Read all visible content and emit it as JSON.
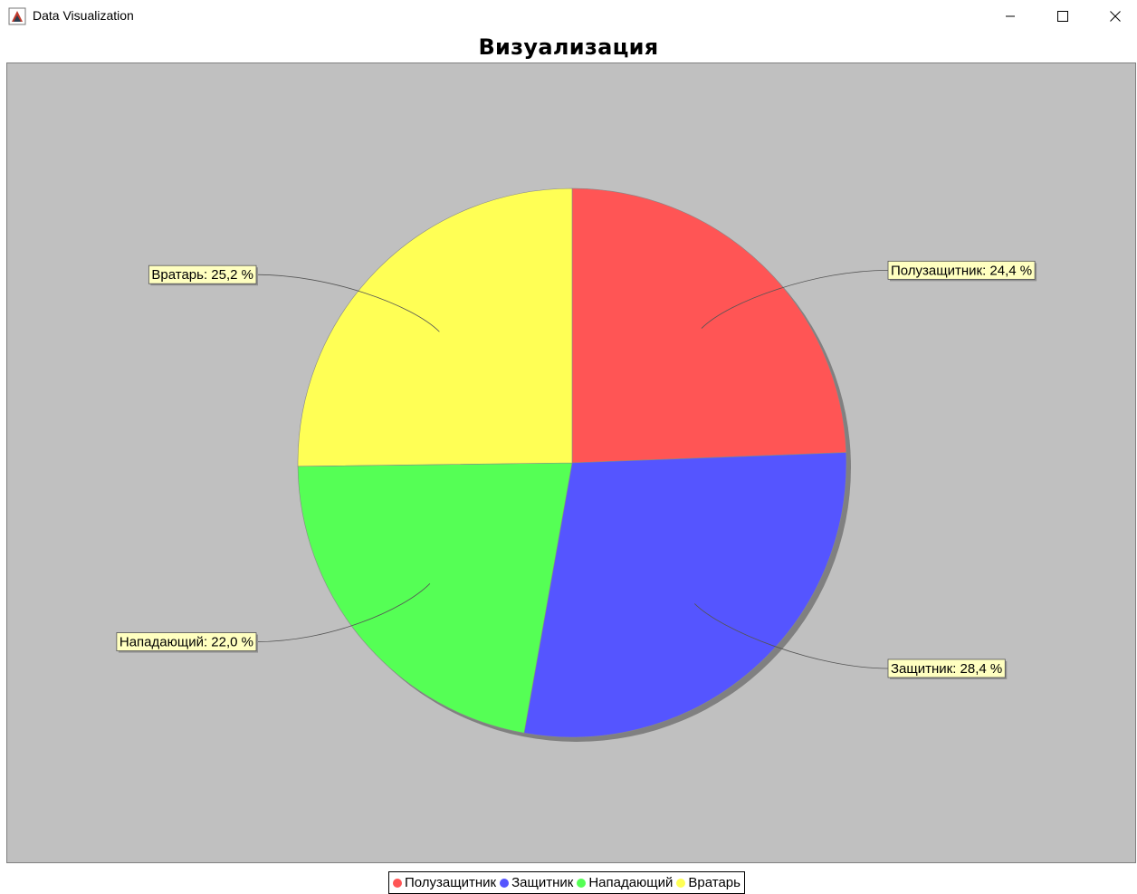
{
  "window": {
    "title": "Data Visualization",
    "controls": [
      "minimize",
      "maximize",
      "close"
    ]
  },
  "chart_data": {
    "type": "pie",
    "title": "Визуализация",
    "slices": [
      {
        "name": "Полузащитник",
        "value": 24.4,
        "label": "Полузащитник: 24,4 %",
        "color": "#ff5555"
      },
      {
        "name": "Защитник",
        "value": 28.4,
        "label": "Защитник: 28,4 %",
        "color": "#5555ff"
      },
      {
        "name": "Нападающий",
        "value": 22.0,
        "label": "Нападающий: 22,0 %",
        "color": "#55ff55"
      },
      {
        "name": "Вратарь",
        "value": 25.2,
        "label": "Вратарь: 25,2 %",
        "color": "#ffff55"
      }
    ],
    "legend_position": "bottom",
    "background": "#c0c0c0",
    "label_background": "#ffffc0"
  }
}
